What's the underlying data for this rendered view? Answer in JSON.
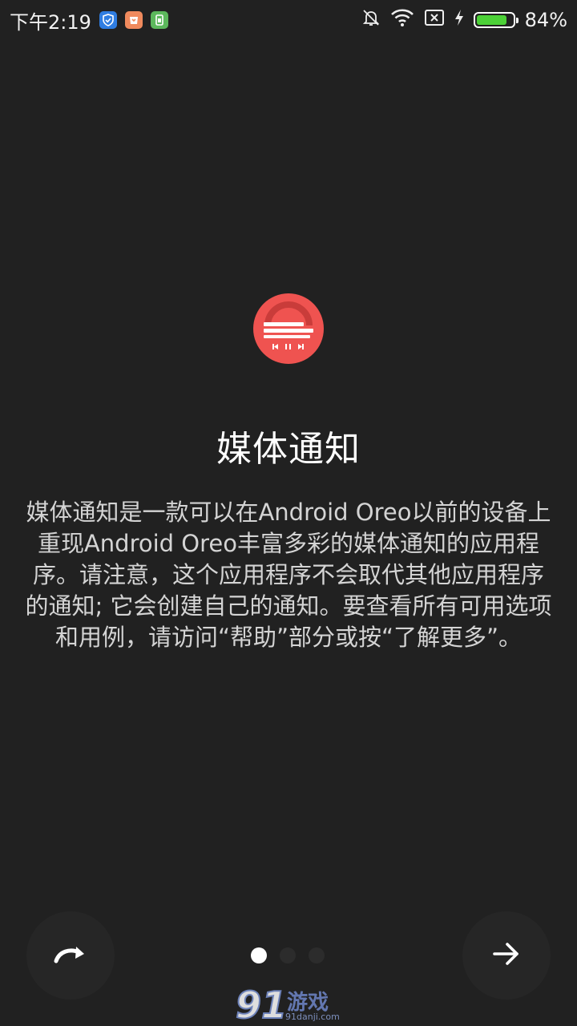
{
  "status_bar": {
    "time": "下午2:19",
    "battery_percent_text": "84%",
    "battery_level": 0.84,
    "icons": [
      "shield-app-icon",
      "store-app-icon",
      "sim-app-icon",
      "mute-icon",
      "wifi-icon",
      "no-sim-icon",
      "charging-icon",
      "battery-icon"
    ]
  },
  "hero": {
    "icon": "media-notification-app-icon",
    "accent_color": "#ef5350"
  },
  "title": "媒体通知",
  "description": "媒体通知是一款可以在Android Oreo以前的设备上重现Android Oreo丰富多彩的媒体通知的应用程序。请注意，这个应用程序不会取代其他应用程序的通知; 它会创建自己的通知。要查看所有可用选项和用例，请访问“帮助”部分或按“了解更多”。",
  "navigation": {
    "skip_icon": "skip-icon",
    "next_icon": "arrow-right-icon",
    "pages": 3,
    "current_page": 1
  },
  "watermark": {
    "brand": "游戏",
    "number": "91",
    "url": "91danji.com"
  }
}
